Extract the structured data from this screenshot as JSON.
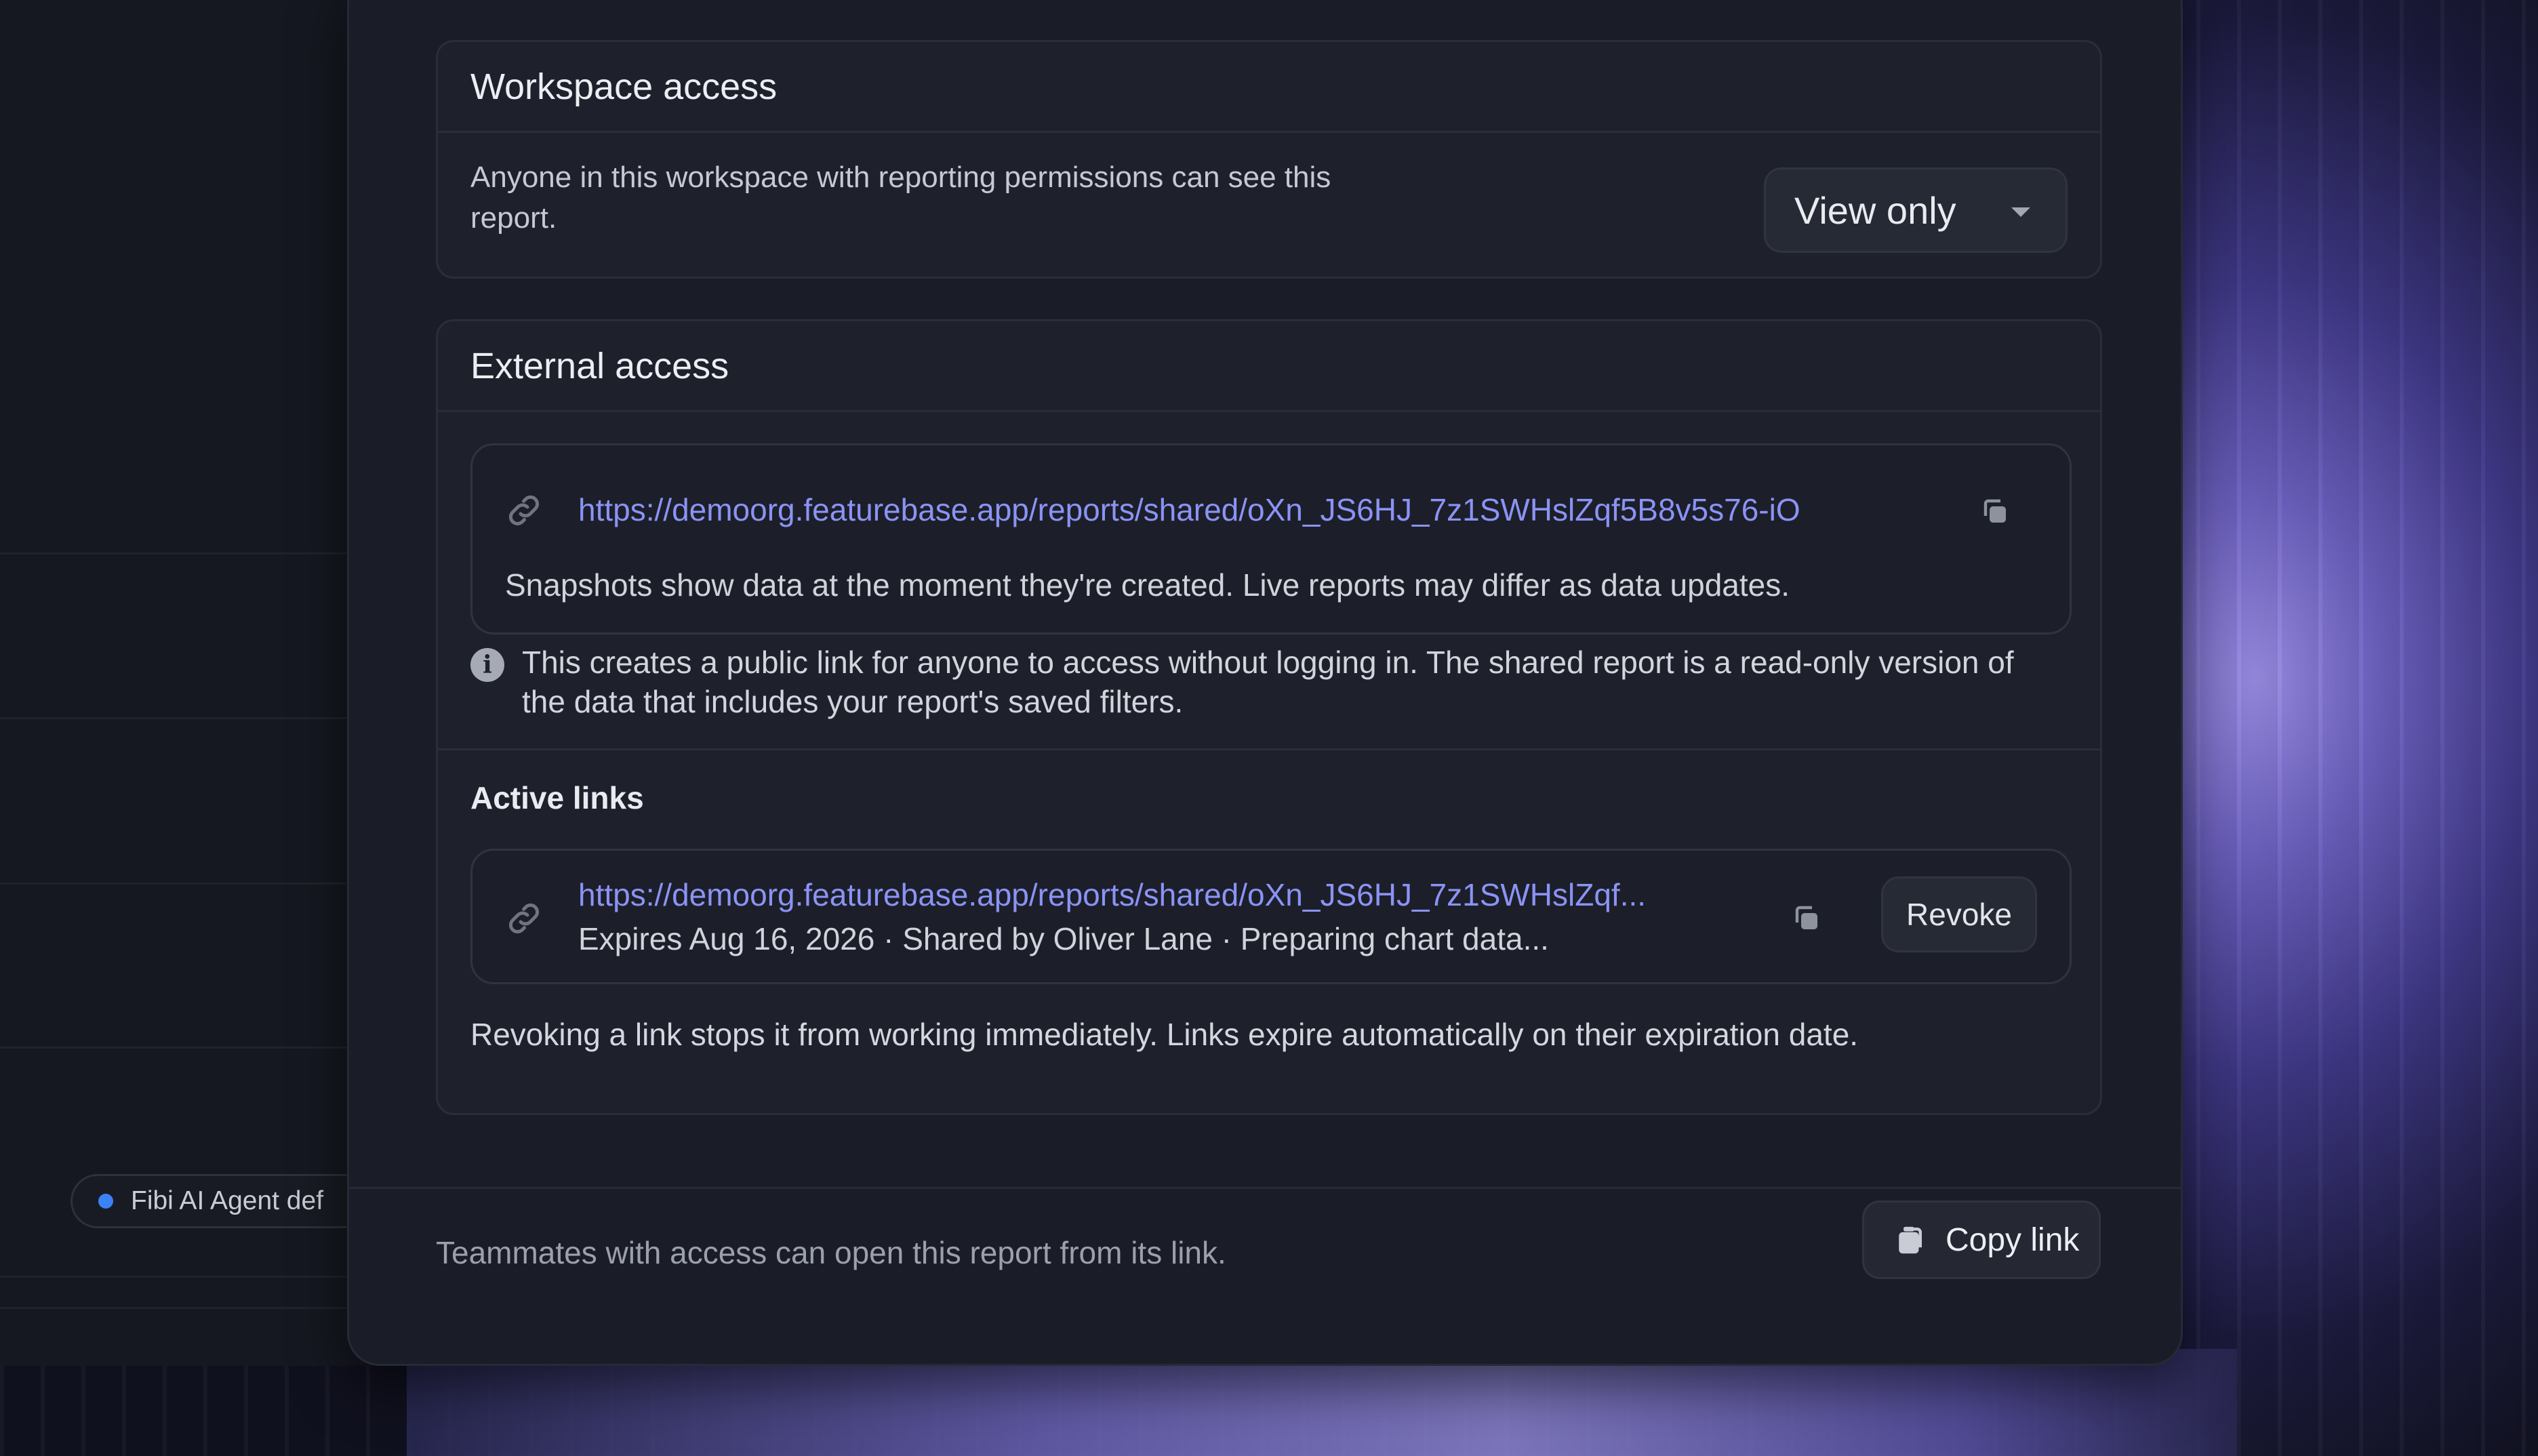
{
  "background": {
    "chip_label": "Fibi AI Agent def"
  },
  "workspace_access": {
    "title": "Workspace access",
    "description": "Anyone in this workspace with reporting permissions can see this report.",
    "permission_select": "View only"
  },
  "external_access": {
    "title": "External access",
    "share_url": "https://demoorg.featurebase.app/reports/shared/oXn_JS6HJ_7z1SWHslZqf5B8v5s76-iO",
    "snapshot_note": "Snapshots show data at the moment they're created. Live reports may differ as data updates.",
    "info_text": "This creates a public link for anyone to access without logging in. The shared report is a read-only version of the data that includes your report's saved filters.",
    "active_links_label": "Active links",
    "active_links": [
      {
        "url": "https://demoorg.featurebase.app/reports/shared/oXn_JS6HJ_7z1SWHslZqf...",
        "meta": "Expires Aug 16, 2026 · Shared by Oliver Lane · Preparing chart data...",
        "revoke_label": "Revoke"
      }
    ],
    "revoke_note": "Revoking a link stops it from working immediately. Links expire automatically on their expiration date."
  },
  "footer": {
    "text": "Teammates with access can open this report from its link.",
    "copy_link_label": "Copy link"
  },
  "colors": {
    "link": "#8b93f5",
    "panel_bg": "#1e212c",
    "modal_bg": "#1a1d27",
    "accent_dot": "#3b82f6"
  },
  "icons": [
    "link-icon",
    "copy-icon",
    "info-icon",
    "chevron-down-icon",
    "clipboard-icon"
  ]
}
